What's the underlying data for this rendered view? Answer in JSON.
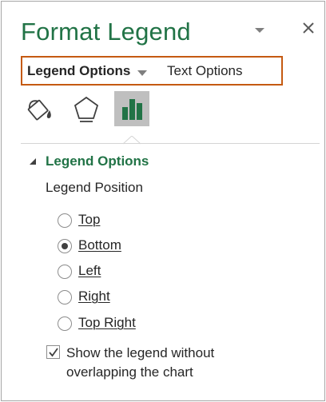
{
  "pane": {
    "title": "Format Legend"
  },
  "tabs": {
    "legend_options": "Legend Options",
    "text_options": "Text Options"
  },
  "icons": {
    "fill_line": "paint-bucket-icon",
    "effects": "pentagon-icon",
    "legend_options": "bar-chart-icon"
  },
  "section": {
    "title": "Legend Options",
    "position_label": "Legend Position"
  },
  "positions": [
    {
      "label": "Top",
      "checked": false
    },
    {
      "label": "Bottom",
      "checked": true
    },
    {
      "label": "Left",
      "checked": false
    },
    {
      "label": "Right",
      "checked": false
    },
    {
      "label": "Top Right",
      "checked": false
    }
  ],
  "overlap_option": {
    "label_line1": "Show the legend without",
    "label_line2": "overlapping the chart",
    "checked": true
  },
  "colors": {
    "accent_green": "#217346",
    "tab_border": "#c55a11",
    "selected_icon_bg": "#bfbfbf"
  }
}
